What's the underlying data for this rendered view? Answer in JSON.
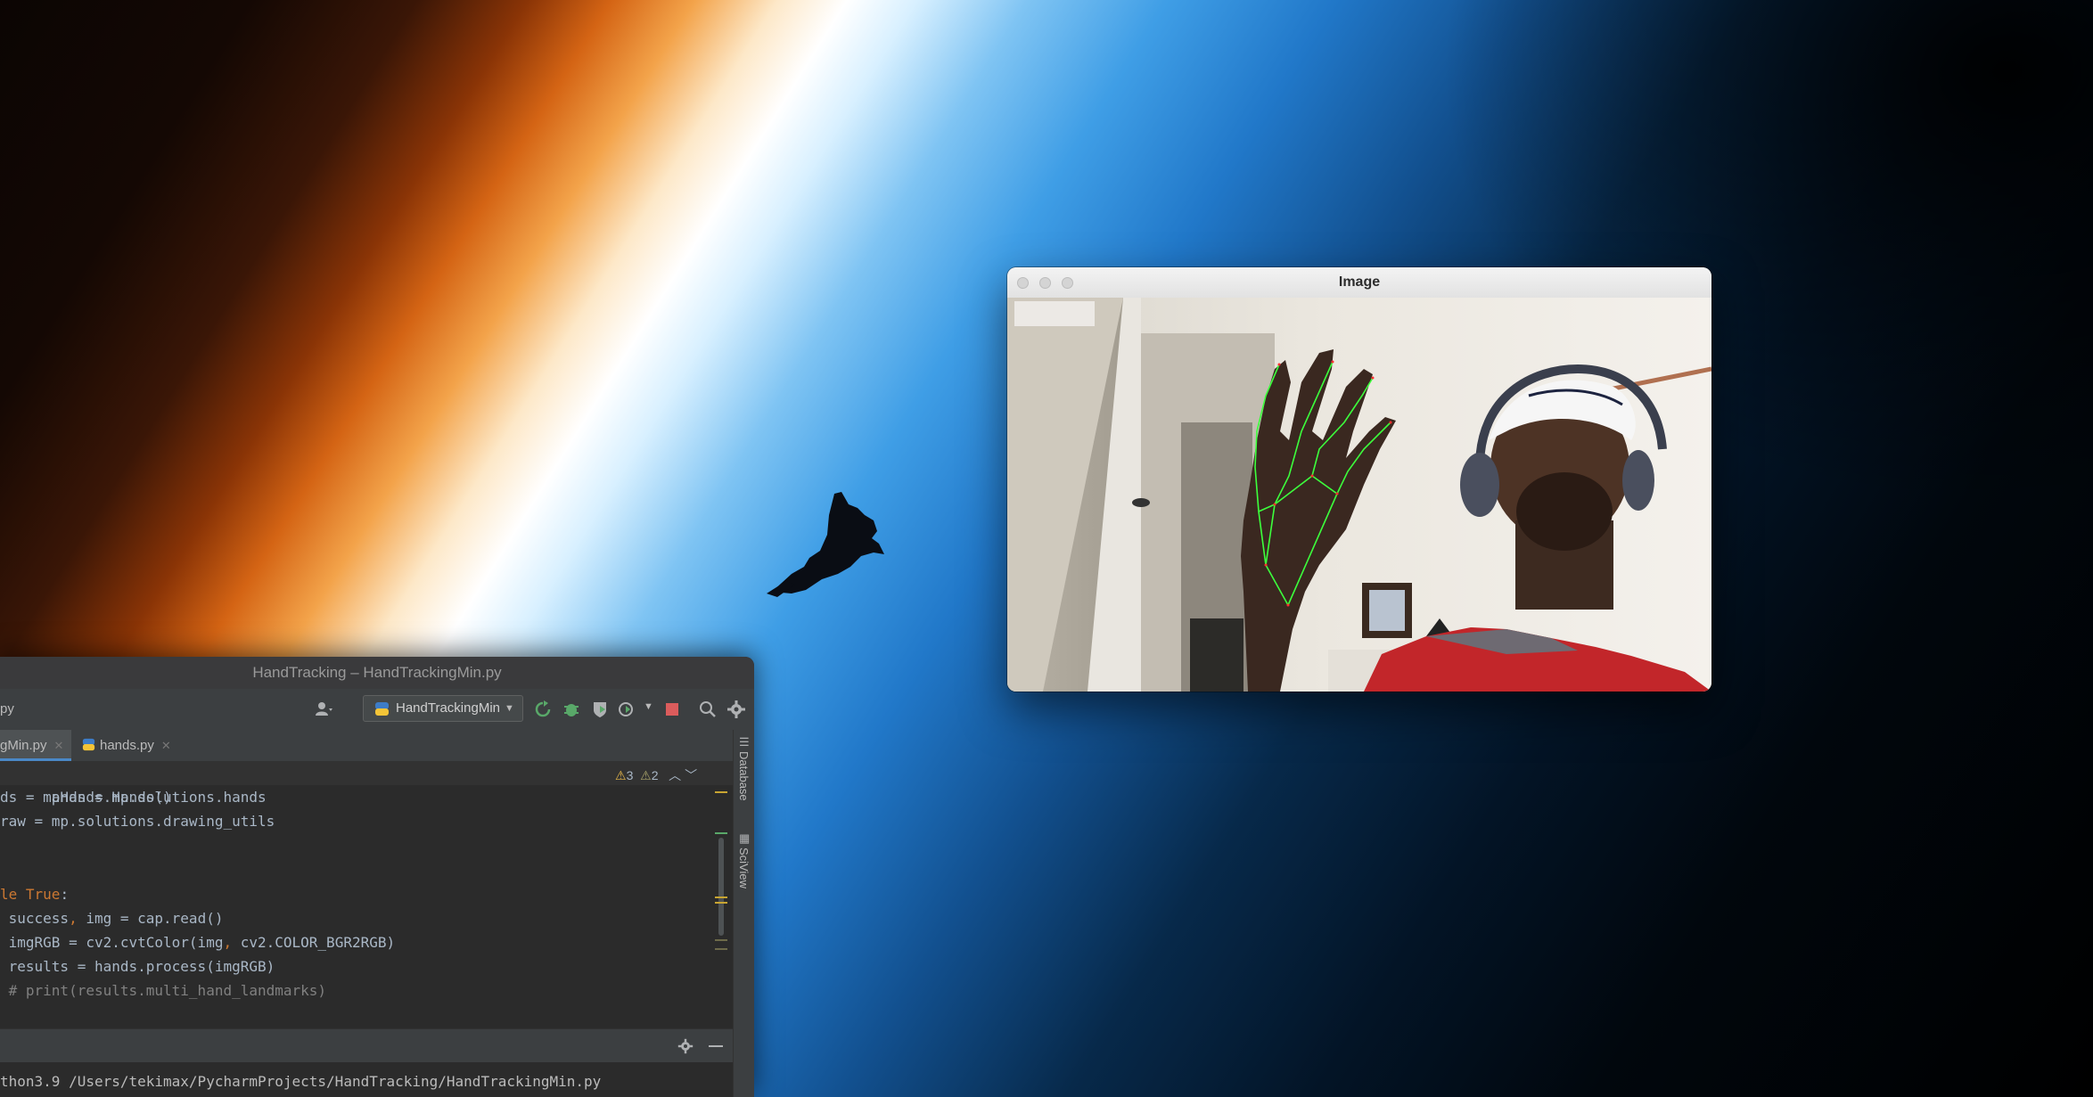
{
  "image_window": {
    "title": "Image"
  },
  "ide": {
    "window_title": "HandTracking – HandTrackingMin.py",
    "toolbar": {
      "breadcrumb_fragment": "py",
      "run_config": "HandTrackingMin"
    },
    "tabs": [
      {
        "label": "gMin.py",
        "active": true
      },
      {
        "label": "hands.py",
        "active": false
      }
    ],
    "inspections": {
      "warnings": "3",
      "weak_warnings": "2"
    },
    "side_panels": [
      "Database",
      "SciView"
    ],
    "code_lines": [
      {
        "t1": "ands = mp.solutions.hands",
        "highlight": true
      },
      {
        "t1": "ds = mpHands.Hands()"
      },
      {
        "t1": "raw = mp.solutions.drawing_utils"
      },
      {
        "t1": ""
      },
      {
        "t1": ""
      },
      {
        "kw": "le True",
        "t2": ":"
      },
      {
        "t1": " success",
        "kw2": ",",
        "t2": " img = cap.read()"
      },
      {
        "t1": " imgRGB = cv2.cvtColor(img",
        "kw2": ",",
        "t2": " cv2.COLOR_BGR2RGB)"
      },
      {
        "t1": " results = hands.process(imgRGB)"
      },
      {
        "cm": " # print(results.multi_hand_landmarks)"
      }
    ],
    "console_text": "thon3.9 /Users/tekimax/PycharmProjects/HandTracking/HandTrackingMin.py"
  },
  "colors": {
    "keyword": "#cc7832",
    "comment": "#808080",
    "code": "#a9b7c6",
    "ide_bg": "#2b2b2b",
    "landmark_green": "#3cff3c"
  },
  "icons": [
    "shuttle-silhouette",
    "close-dot",
    "minimize-dot",
    "zoom-dot",
    "user-icon",
    "python-icon",
    "rerun-icon",
    "debug-icon",
    "coverage-icon",
    "profile-icon",
    "stop-icon",
    "search-icon",
    "gear-icon",
    "warning-icon",
    "minimize-panel-icon"
  ]
}
